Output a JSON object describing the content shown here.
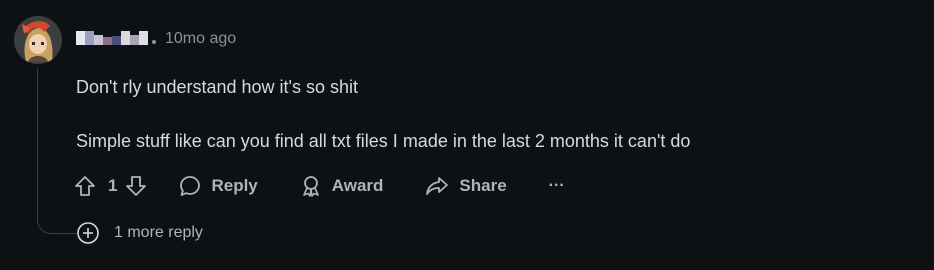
{
  "comment": {
    "timestamp": "10mo ago",
    "body_line_1": "Don't rly understand how it's so shit",
    "body_line_2": "Simple stuff like can you find all txt files I made in the last 2 months it can't do",
    "vote_count": "1",
    "actions": {
      "reply_label": "Reply",
      "award_label": "Award",
      "share_label": "Share",
      "more_label": "···"
    },
    "more_replies_label": "1 more reply"
  },
  "icons": {
    "upvote": "arrow-up-icon",
    "downvote": "arrow-down-icon",
    "reply": "speech-bubble-icon",
    "award": "award-ribbon-icon",
    "share": "share-arrow-icon",
    "more": "ellipsis-icon",
    "expand": "plus-circle-icon"
  },
  "colors": {
    "background": "#0e1113",
    "text": "#d7dadc",
    "muted": "#8a9297",
    "action": "#aeb4b8"
  }
}
